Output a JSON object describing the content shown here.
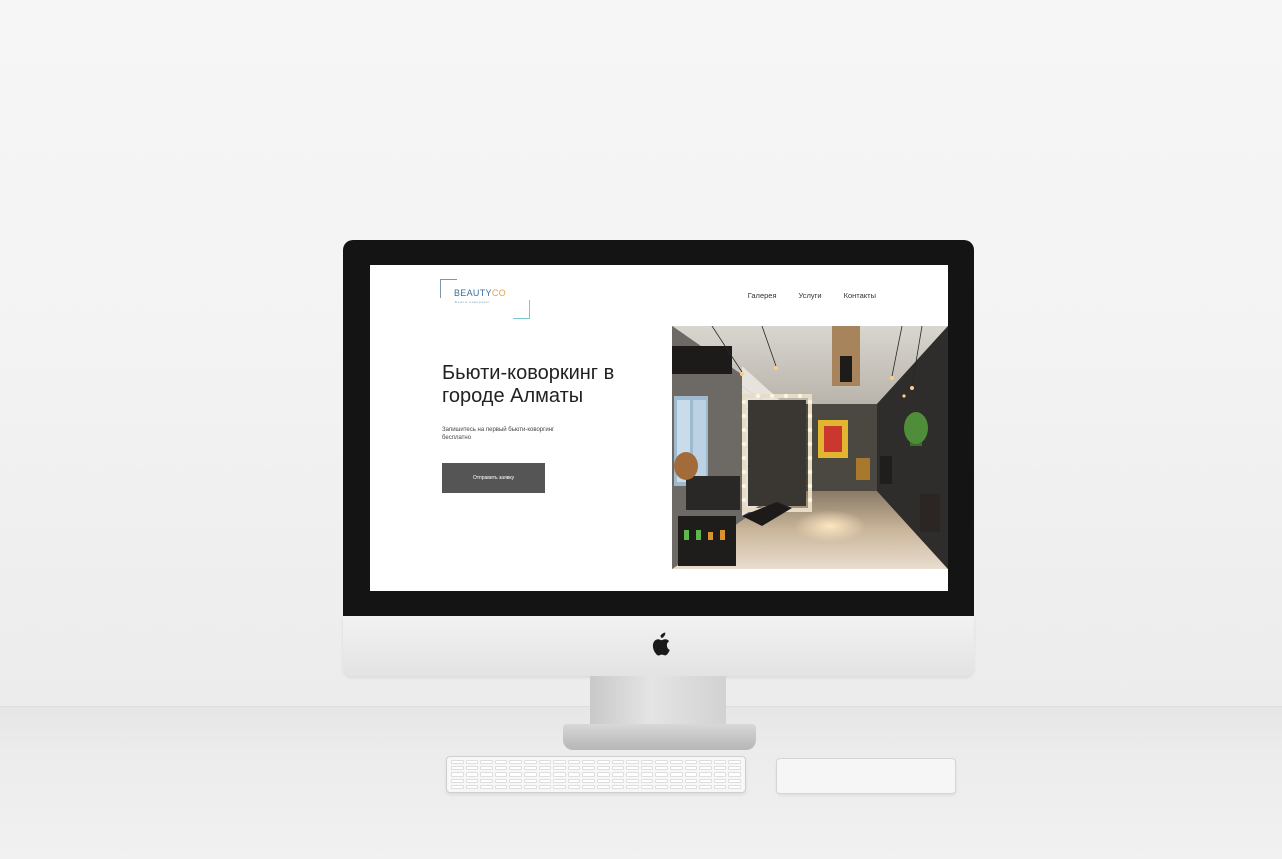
{
  "site": {
    "logo": {
      "brand_main": "BEAUTY",
      "brand_accent": "CO",
      "tagline": "Бьюти-коворкинг"
    },
    "nav": [
      {
        "label": "Галерея"
      },
      {
        "label": "Услуги"
      },
      {
        "label": "Контакты"
      }
    ],
    "hero": {
      "title": "Бьюти-коворкинг в городе Алматы",
      "subtitle": "Запишитесь на первый бьюти-коворгинг бесплатно",
      "button_label": "Отправить заявку"
    }
  },
  "colors": {
    "bezel": "#141414",
    "button": "#555555",
    "logo_blue": "#3a6f9a",
    "logo_orange": "#e6a24a"
  },
  "icons": [
    "apple-logo-icon"
  ]
}
